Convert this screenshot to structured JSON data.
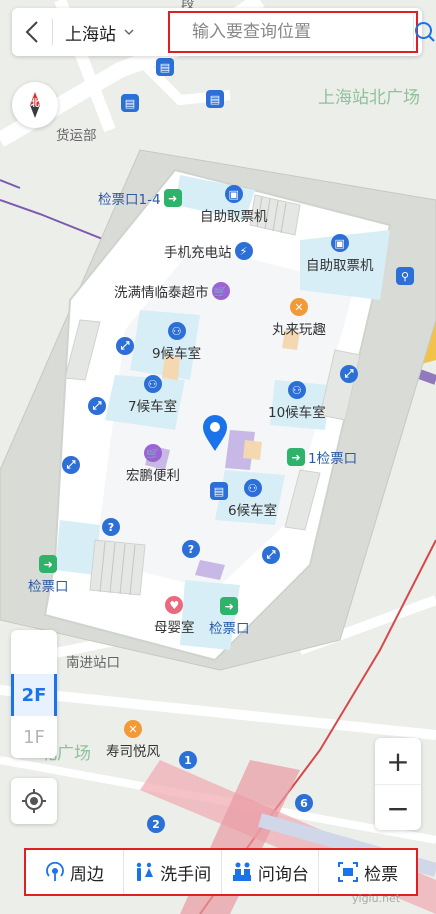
{
  "header": {
    "station": "上海站",
    "search_placeholder": "输入要查询位置"
  },
  "compass": {
    "label": "北"
  },
  "floors": {
    "items": [
      "2F",
      "1F"
    ],
    "active": "2F"
  },
  "zoom": {
    "in": "+",
    "out": "−"
  },
  "map": {
    "labels": {
      "north_square": "上海站北广场",
      "freight": "货运部",
      "south_exit": "南进站口",
      "plaza_cut": "北广场",
      "hall_9": "9候车室",
      "hall_7": "7候车室",
      "hall_10": "10候车室",
      "hall_6": "6候车室",
      "ticket_check_1_4": "检票口1-4",
      "ticket_check_1": "1检票口",
      "ticket_check_left": "检票口",
      "ticket_check_bottom": "检票口",
      "ticket_machine_1": "自助取票机",
      "ticket_machine_2": "自助取票机",
      "charging": "手机充电站",
      "supermarket": "洗满情临泰超市",
      "hongpeng": "宏鹏便利",
      "wanlai": "丸来玩趣",
      "nursing": "母婴室",
      "sushi": "寿司悦风",
      "top_cut": "段"
    },
    "metro_exits": [
      "1",
      "2",
      "6"
    ]
  },
  "bottom_bar": [
    {
      "label": "周边",
      "icon": "nearby-icon"
    },
    {
      "label": "洗手间",
      "icon": "restroom-icon"
    },
    {
      "label": "问询台",
      "icon": "info-desk-icon"
    },
    {
      "label": "检票",
      "icon": "ticket-check-icon"
    }
  ],
  "watermark": "yigiu.net"
}
